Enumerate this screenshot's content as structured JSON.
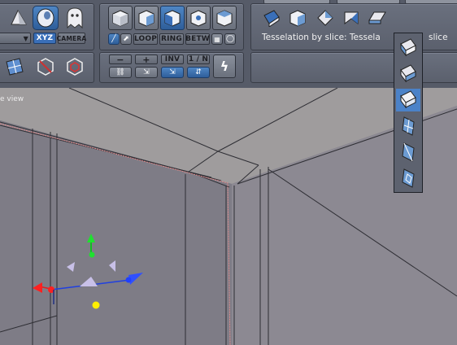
{
  "toolbar": {
    "xyz_label": "XYZ",
    "camera_label": "CAMERA",
    "loop_label": "LOOP",
    "ring_label": "RING",
    "betw_label": "BETW",
    "minus_label": "−",
    "plus_label": "+",
    "inv_label": "INV",
    "one_n_label": "1 / N",
    "status": "Tesselation by slice: Tessela",
    "status_tail": "slice"
  },
  "viewport": {
    "label": "e view"
  },
  "dropdown": {
    "items": [
      "slice-icon-1",
      "slice-icon-2",
      "slice-icon-3",
      "slice-icon-4",
      "slice-icon-5",
      "slice-icon-6"
    ],
    "selected_index": 2
  },
  "colors": {
    "toolbar_bg": "#565b68",
    "viewport_bg": "#7f7d87",
    "accent": "#3a6fb8"
  }
}
